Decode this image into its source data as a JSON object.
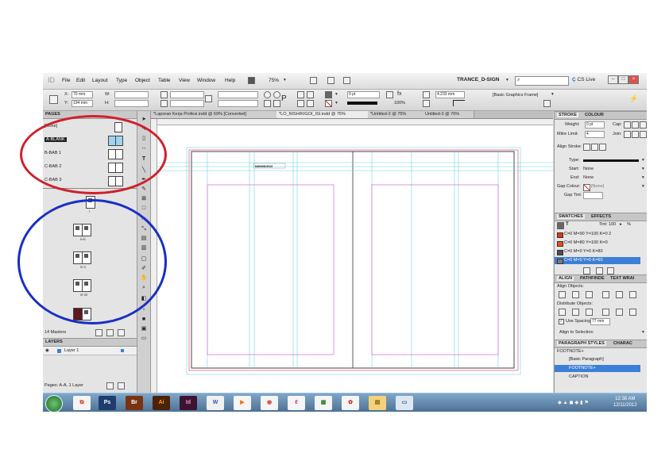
{
  "menubar": {
    "logo": "ID",
    "items": [
      "File",
      "Edit",
      "Layout",
      "Type",
      "Object",
      "Table",
      "View",
      "Window",
      "Help"
    ],
    "zoom": "75%",
    "workspace": "TRANCE_D-SIGN",
    "cs_live": "CS Live"
  },
  "control": {
    "x_label": "X:",
    "x_value": "70 mm",
    "y_label": "Y:",
    "y_value": "194 mm",
    "w_label": "W:",
    "h_label": "H:",
    "stroke_weight": "0 pt",
    "width_value": "4.233 mm",
    "opacity": "100%",
    "object_style": "[Basic Graphics Frame]"
  },
  "pages": {
    "title": "PAGES",
    "masters": [
      {
        "label": "[None]",
        "selected": false
      },
      {
        "label": "A-BLANK",
        "selected": true
      },
      {
        "label": "B-BAB 1",
        "selected": false
      },
      {
        "label": "C-BAB 2",
        "selected": false
      },
      {
        "label": "C-BAB 3",
        "selected": false
      }
    ],
    "spread_labels": [
      "i",
      "ii-iii",
      "iv-v",
      "vi-vii"
    ],
    "footer": "14 Masters"
  },
  "layers": {
    "title": "LAYERS",
    "items": [
      "Layer 1"
    ],
    "status": "Pages: A-A, 1 Layer"
  },
  "tabs": [
    {
      "label": "*Laporan Kerja Profesi.indd @ 69% [Converted]",
      "active": false
    },
    {
      "label": "*LO_NISHIKIGOI_ISI.indd @ 75%",
      "active": true
    },
    {
      "label": "*Untitled-2 @ 75%",
      "active": false
    },
    {
      "label": "Untitled-3 @ 76%",
      "active": false
    }
  ],
  "document": {
    "header_text": "NISHIKIGOI"
  },
  "stroke_panel": {
    "tabs": [
      "STROKE",
      "COLOUR"
    ],
    "weight_label": "Weight:",
    "weight_value": "0 pt",
    "cap_label": "Cap:",
    "mitre_label": "Mitre Limit:",
    "mitre_value": "4",
    "join_label": "Join:",
    "align_label": "Align Stroke:",
    "type_label": "Type:",
    "start_label": "Start:",
    "start_value": "None",
    "end_label": "End:",
    "end_value": "None",
    "gap_colour_label": "Gap Colour:",
    "gap_colour_value": "[None]",
    "gap_tint_label": "Gap Tint:"
  },
  "swatches_panel": {
    "tabs": [
      "SWATCHES",
      "EFFECTS"
    ],
    "tint_label": "Tint:",
    "tint_value": "100",
    "tint_unit": "%",
    "items": [
      {
        "label": "C=0 M=90 Y=100 K=0 2",
        "color": "#e2341b",
        "selected": false
      },
      {
        "label": "C=0 M=80 Y=100 K=0",
        "color": "#e84e1b",
        "selected": false
      },
      {
        "label": "C=0 M=0 Y=0 K=80",
        "color": "#4d4d4d",
        "selected": false
      },
      {
        "label": "C=0 M=0 Y=0 K=60",
        "color": "#7a7a7a",
        "selected": true
      }
    ]
  },
  "align_panel": {
    "tabs": [
      "ALIGN",
      "PATHFINDE",
      "TEXT WRAI"
    ],
    "align_objects": "Align Objects:",
    "distribute_objects": "Distribute Objects:",
    "use_spacing": "Use Spacing",
    "spacing_value": "77 mm",
    "align_to": "Align to Selection"
  },
  "paragraph_panel": {
    "tabs": [
      "PARAGRAPH STYLES",
      "CHARAC"
    ],
    "current": "FOOTNOTE+",
    "items": [
      {
        "label": "[Basic Paragraph]",
        "selected": false
      },
      {
        "label": "FOOTNOTE+",
        "selected": true
      },
      {
        "label": "CAPTION",
        "selected": false
      }
    ]
  },
  "taskbar": {
    "time": "12:38 AM",
    "date": "12/11/2012",
    "apps": [
      "Ps",
      "Br",
      "Ai",
      "Id"
    ]
  },
  "colors": {
    "annotation_red": "#d0202a",
    "annotation_blue": "#1a2fc4",
    "guide_cyan": "#6ed2dd",
    "margin_magenta": "#d47ad9",
    "selection_blue": "#3d7fd6"
  }
}
